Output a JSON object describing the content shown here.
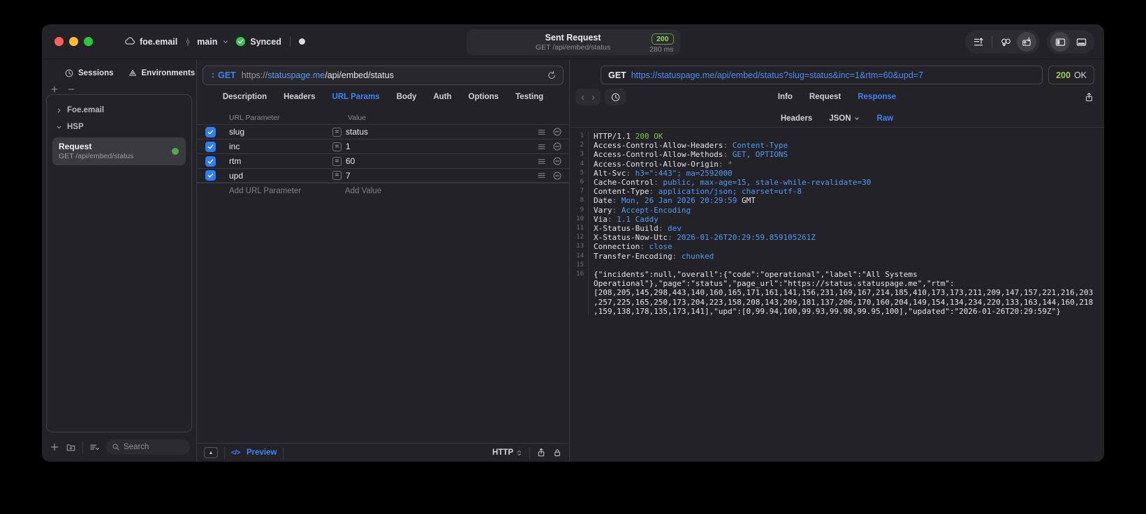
{
  "colors": {
    "accent": "#3f83f8",
    "green_badge": "#93d967",
    "mono_blue": "#4f9cf8",
    "mono_green": "#77c94c",
    "checkbox_blue": "#2e7cf6",
    "status_dot": "#55a74e"
  },
  "icons": {
    "back": "‹",
    "forward": "›",
    "collapse": "▲",
    "code": "</>",
    "equals": "="
  },
  "titlebar": {
    "project": "foe.email",
    "branch": "main",
    "sync_status": "Synced",
    "center": {
      "title": "Sent Request",
      "subtitle": "GET /api/embed/status",
      "status_code": "200",
      "duration": "280 ms"
    }
  },
  "sidebar": {
    "tabs": [
      {
        "label": "Sessions"
      },
      {
        "label": "Environments"
      }
    ],
    "tree": {
      "workspace": "Foe.email",
      "group": "HSP",
      "request": {
        "title": "Request",
        "subtitle": "GET /api/embed/status"
      }
    },
    "search_placeholder": "Search"
  },
  "request_pane": {
    "method": "GET",
    "url_scheme": "https://",
    "url_host": "statuspage.me",
    "url_path": "/api/embed/status",
    "tabs": [
      "Description",
      "Headers",
      "URL Params",
      "Body",
      "Auth",
      "Options",
      "Testing"
    ],
    "active_tab": "URL Params",
    "table": {
      "col1": "URL Parameter",
      "col2": "Value",
      "rows": [
        {
          "name": "slug",
          "value": "status",
          "checked": true
        },
        {
          "name": "inc",
          "value": "1",
          "checked": true
        },
        {
          "name": "rtm",
          "value": "60",
          "checked": true
        },
        {
          "name": "upd",
          "value": "7",
          "checked": true
        }
      ],
      "add_name": "Add URL Parameter",
      "add_value": "Add Value"
    },
    "footer": {
      "preview": "Preview",
      "protocol": "HTTP"
    }
  },
  "response_pane": {
    "method": "GET",
    "url": "https://statuspage.me/api/embed/status?slug=status&inc=1&rtm=60&upd=7",
    "status": "200",
    "status_ok": "OK",
    "tabs": [
      "Info",
      "Request",
      "Response"
    ],
    "active_tab": "Response",
    "subtabs": [
      "Headers",
      "JSON",
      "Raw"
    ],
    "active_subtab": "Raw",
    "lines": [
      {
        "n": "1",
        "parts": [
          {
            "t": "HTTP/1.1 ",
            "c": "w"
          },
          {
            "t": "200 OK",
            "c": "g"
          }
        ]
      },
      {
        "n": "2",
        "parts": [
          {
            "t": "Access-Control-Allow-Headers",
            "c": "w"
          },
          {
            "t": ": ",
            "c": "d"
          },
          {
            "t": "Content-Type",
            "c": "b"
          }
        ]
      },
      {
        "n": "3",
        "parts": [
          {
            "t": "Access-Control-Allow-Methods",
            "c": "w"
          },
          {
            "t": ": ",
            "c": "d"
          },
          {
            "t": "GET, OPTIONS",
            "c": "b"
          }
        ]
      },
      {
        "n": "4",
        "parts": [
          {
            "t": "Access-Control-Allow-Origin",
            "c": "w"
          },
          {
            "t": ": ",
            "c": "d"
          },
          {
            "t": "*",
            "c": "d"
          }
        ]
      },
      {
        "n": "5",
        "parts": [
          {
            "t": "Alt-Svc",
            "c": "w"
          },
          {
            "t": ": ",
            "c": "d"
          },
          {
            "t": "h3=\":443\"; ma=2592000",
            "c": "b"
          }
        ]
      },
      {
        "n": "6",
        "parts": [
          {
            "t": "Cache-Control",
            "c": "w"
          },
          {
            "t": ": ",
            "c": "d"
          },
          {
            "t": "public, max-age=15, stale-while-revalidate=30",
            "c": "b"
          }
        ]
      },
      {
        "n": "7",
        "parts": [
          {
            "t": "Content-Type",
            "c": "w"
          },
          {
            "t": ": ",
            "c": "d"
          },
          {
            "t": "application/json; charset=utf-8",
            "c": "b"
          }
        ]
      },
      {
        "n": "8",
        "parts": [
          {
            "t": "Date",
            "c": "w"
          },
          {
            "t": ": ",
            "c": "d"
          },
          {
            "t": "Mon, 26 Jan 2026 20:29:59",
            "c": "b"
          },
          {
            "t": " GMT",
            "c": "w"
          }
        ]
      },
      {
        "n": "9",
        "parts": [
          {
            "t": "Vary",
            "c": "w"
          },
          {
            "t": ": ",
            "c": "d"
          },
          {
            "t": "Accept-Encoding",
            "c": "b"
          }
        ]
      },
      {
        "n": "10",
        "parts": [
          {
            "t": "Via",
            "c": "w"
          },
          {
            "t": ": ",
            "c": "d"
          },
          {
            "t": "1.1 Caddy",
            "c": "b"
          }
        ]
      },
      {
        "n": "11",
        "parts": [
          {
            "t": "X-Status-Build",
            "c": "w"
          },
          {
            "t": ": ",
            "c": "d"
          },
          {
            "t": "dev",
            "c": "b"
          }
        ]
      },
      {
        "n": "12",
        "parts": [
          {
            "t": "X-Status-Now-Utc",
            "c": "w"
          },
          {
            "t": ": ",
            "c": "d"
          },
          {
            "t": "2026-01-26T20:29:59.859105261Z",
            "c": "b"
          }
        ]
      },
      {
        "n": "13",
        "parts": [
          {
            "t": "Connection",
            "c": "w"
          },
          {
            "t": ": ",
            "c": "d"
          },
          {
            "t": "close",
            "c": "b"
          }
        ]
      },
      {
        "n": "14",
        "parts": [
          {
            "t": "Transfer-Encoding",
            "c": "w"
          },
          {
            "t": ": ",
            "c": "d"
          },
          {
            "t": "chunked",
            "c": "b"
          }
        ]
      },
      {
        "n": "15",
        "parts": []
      },
      {
        "n": "16",
        "parts": [
          {
            "t": "{\"incidents\":null,\"overall\":{\"code\":\"operational\",\"label\":\"All Systems Operational\"},\"page\":\"status\",\"page_url\":\"https://status.statuspage.me\",\"rtm\":[208,205,145,298,443,140,160,165,171,161,141,156,231,169,167,214,185,410,173,173,211,209,147,157,221,216,203,257,225,165,250,173,204,223,158,208,143,209,181,137,206,170,160,204,149,154,134,234,220,133,163,144,160,218,159,138,178,135,173,141],\"upd\":[0,99.94,100,99.93,99.98,99.95,100],\"updated\":\"2026-01-26T20:29:59Z\"}",
            "c": "w"
          }
        ]
      }
    ]
  }
}
